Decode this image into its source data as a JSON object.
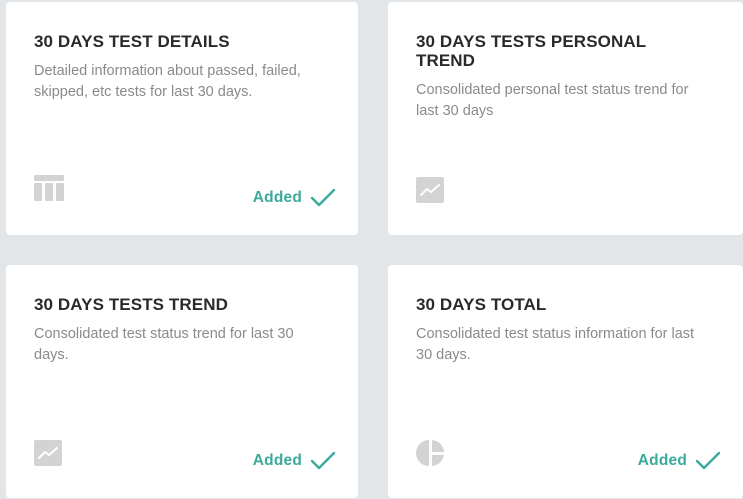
{
  "colors": {
    "background": "#e3e6e9",
    "card": "#ffffff",
    "title": "#2a2a2a",
    "description": "#8a8a8a",
    "accent": "#3aaa9a",
    "icon": "#d3d3d3"
  },
  "cards": [
    {
      "title": "30 DAYS TEST DETAILS",
      "description": "Detailed information about passed, failed, skipped, etc tests for last 30 days.",
      "icon": "table-icon",
      "status": "Added"
    },
    {
      "title": "30 DAYS TESTS PERSONAL TREND",
      "description": "Consolidated personal test status trend for last 30 days",
      "icon": "trend-chart-icon",
      "status": ""
    },
    {
      "title": "30 DAYS TESTS TREND",
      "description": "Consolidated test status trend for last 30 days.",
      "icon": "trend-chart-icon",
      "status": "Added"
    },
    {
      "title": "30 DAYS TOTAL",
      "description": "Consolidated test status information for last 30 days.",
      "icon": "pie-chart-icon",
      "status": "Added"
    }
  ]
}
